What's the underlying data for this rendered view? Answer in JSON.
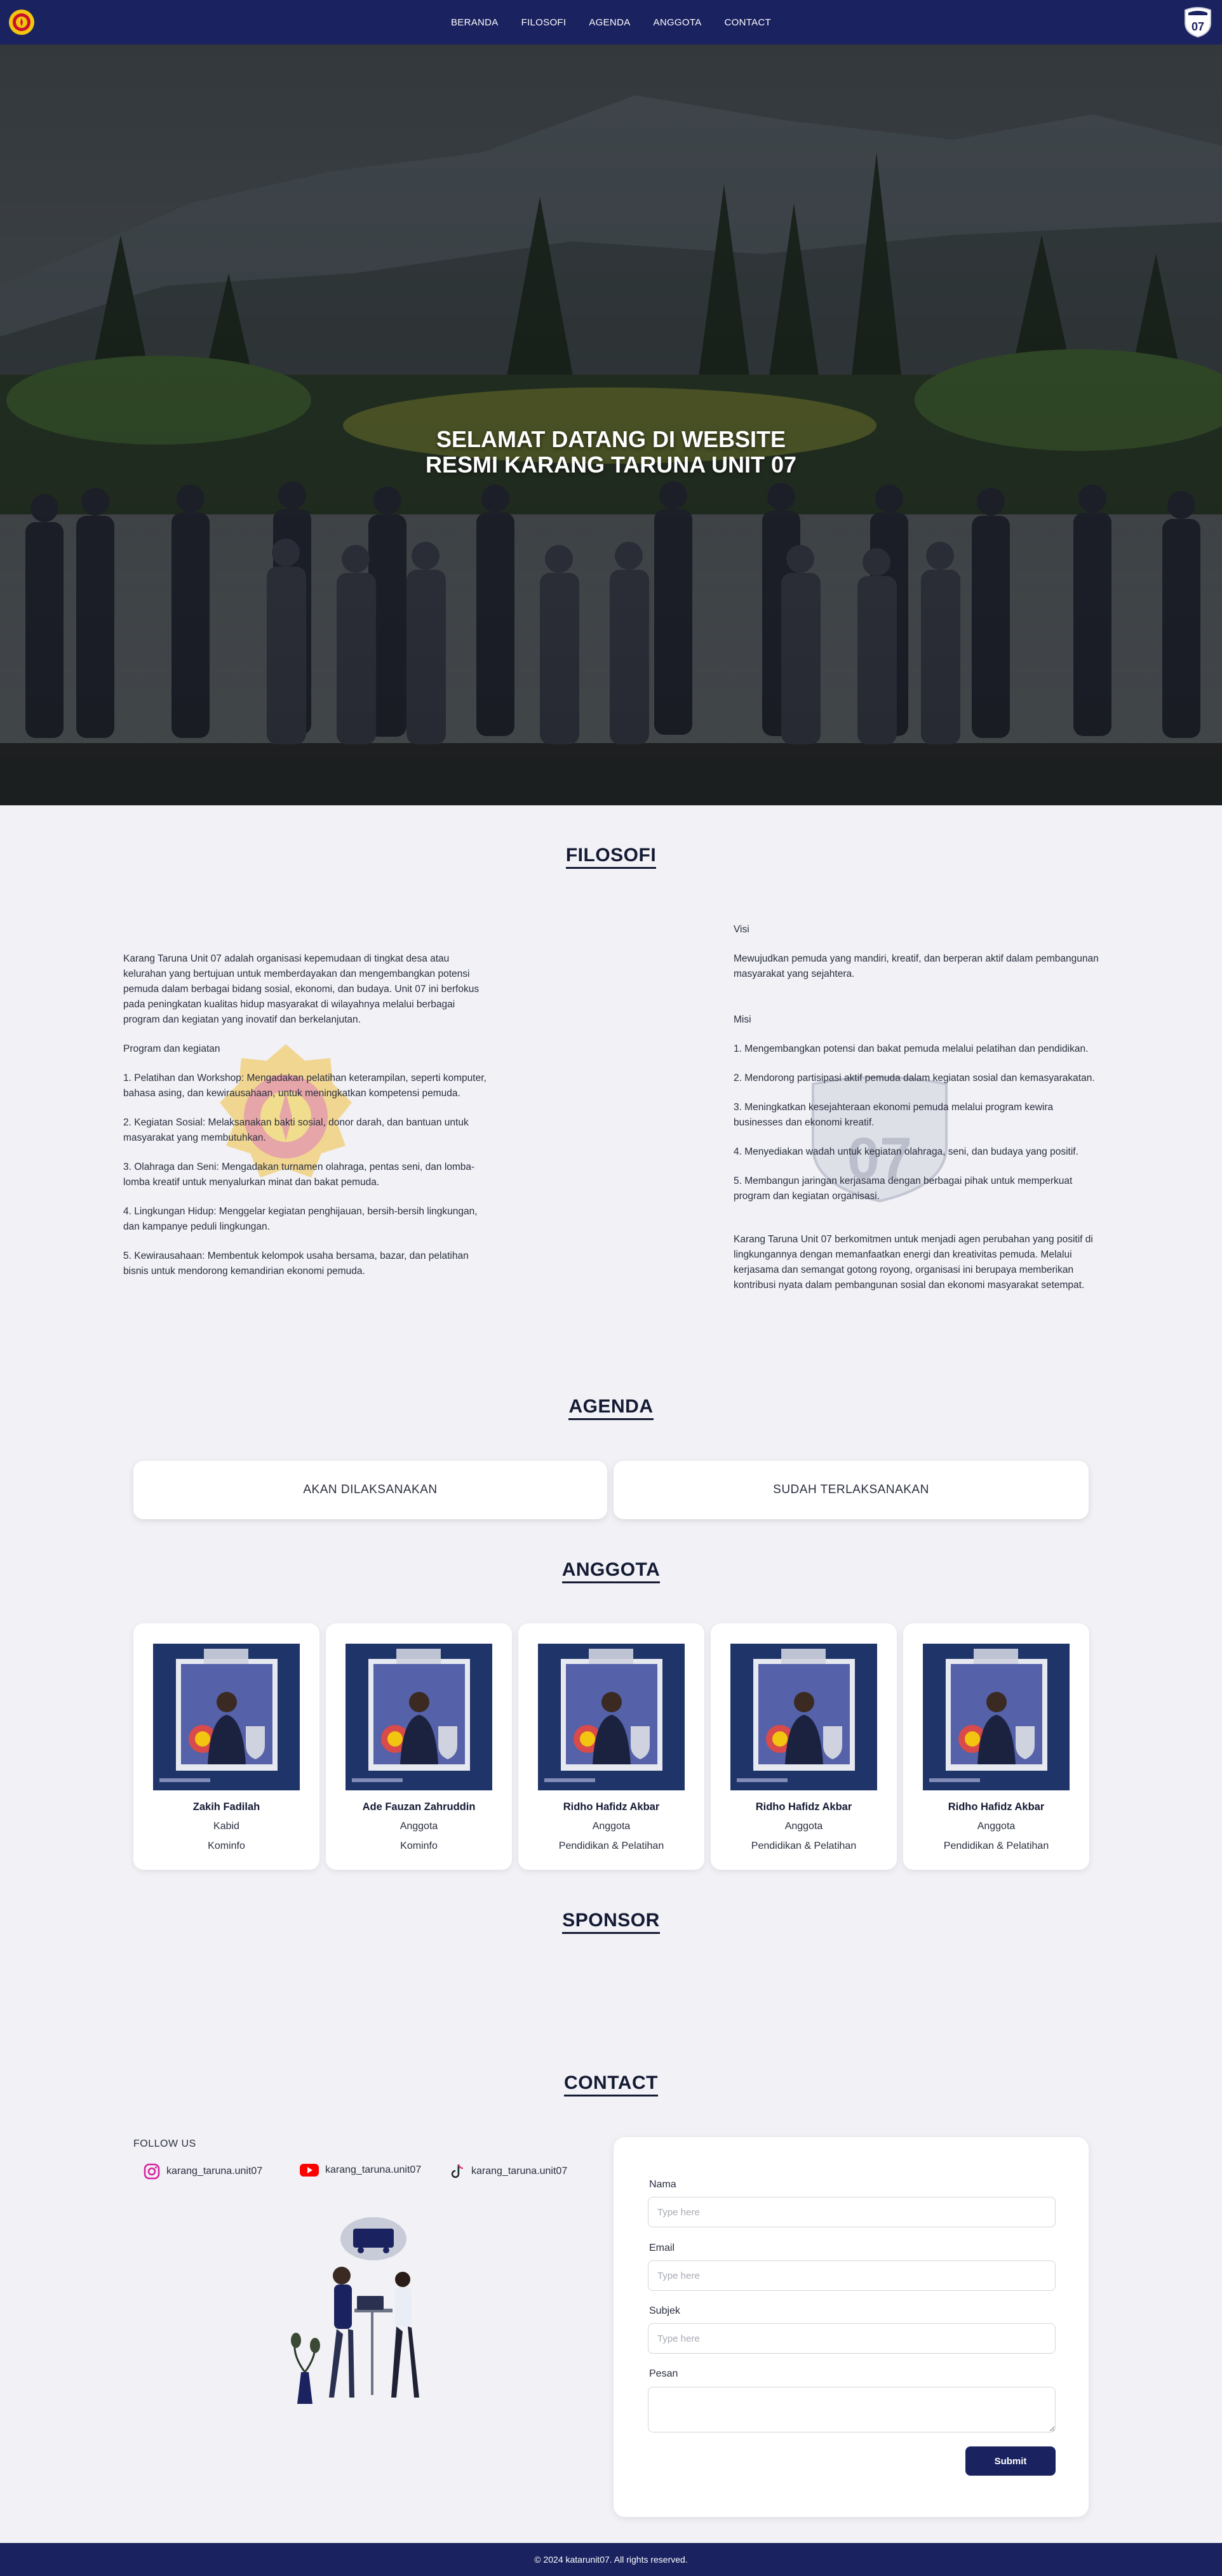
{
  "nav": {
    "links": [
      "BERANDA",
      "FILOSOFI",
      "AGENDA",
      "ANGGOTA",
      "CONTACT"
    ],
    "logo_right_text": "07"
  },
  "hero": {
    "title": "SELAMAT DATANG DI WEBSITE RESMI KARANG TARUNA UNIT 07"
  },
  "filosofi": {
    "title": "FILOSOFI",
    "left": {
      "intro": "Karang Taruna Unit 07 adalah organisasi kepemudaan di tingkat desa atau kelurahan yang bertujuan untuk memberdayakan dan mengembangkan potensi pemuda dalam berbagai bidang sosial, ekonomi, dan budaya. Unit 07 ini berfokus pada peningkatan kualitas hidup masyarakat di wilayahnya melalui berbagai program dan kegiatan yang inovatif dan berkelanjutan.",
      "program_heading": "Program dan kegiatan",
      "programs": [
        "1. Pelatihan dan Workshop: Mengadakan pelatihan keterampilan, seperti komputer, bahasa asing, dan kewirausahaan, untuk meningkatkan kompetensi pemuda.",
        "2. Kegiatan Sosial: Melaksanakan bakti sosial, donor darah, dan bantuan untuk masyarakat yang membutuhkan.",
        "3. Olahraga dan Seni: Mengadakan turnamen olahraga, pentas seni, dan lomba-lomba kreatif untuk menyalurkan minat dan bakat pemuda.",
        "4. Lingkungan Hidup: Menggelar kegiatan penghijauan, bersih-bersih lingkungan, dan kampanye peduli lingkungan.",
        "5. Kewirausahaan: Membentuk kelompok usaha bersama, bazar, dan pelatihan bisnis untuk mendorong kemandirian ekonomi pemuda."
      ]
    },
    "right": {
      "visi_heading": "Visi",
      "visi": "Mewujudkan pemuda yang mandiri, kreatif, dan berperan aktif dalam pembangunan masyarakat yang sejahtera.",
      "misi_heading": "Misi",
      "misi": [
        "1. Mengembangkan potensi dan bakat pemuda melalui pelatihan dan pendidikan.",
        "2. Mendorong partisipasi aktif pemuda dalam kegiatan sosial dan kemasyarakatan.",
        "3. Meningkatkan kesejahteraan ekonomi pemuda melalui program kewira businesses dan ekonomi kreatif.",
        "4. Menyediakan wadah untuk kegiatan olahraga, seni, dan budaya yang positif.",
        "5. Membangun jaringan kerjasama dengan berbagai pihak untuk memperkuat program dan kegiatan organisasi."
      ],
      "closing": "Karang Taruna Unit 07 berkomitmen untuk menjadi agen perubahan yang positif di lingkungannya dengan memanfaatkan energi dan kreativitas pemuda. Melalui kerjasama dan semangat gotong royong, organisasi ini berupaya memberikan kontribusi nyata dalam pembangunan sosial dan ekonomi masyarakat setempat."
    },
    "watermark_text": "UNIT 07"
  },
  "agenda": {
    "title": "AGENDA",
    "upcoming_label": "AKAN DILAKSANAKAN",
    "done_label": "SUDAH TERLAKSANAKAN"
  },
  "anggota": {
    "title": "ANGGOTA",
    "members": [
      {
        "name": "Zakih Fadilah",
        "role": "Kabid",
        "division": "Kominfo"
      },
      {
        "name": "Ade Fauzan Zahruddin",
        "role": "Anggota",
        "division": "Kominfo"
      },
      {
        "name": "Ridho Hafidz Akbar",
        "role": "Anggota",
        "division": "Pendidikan & Pelatihan"
      },
      {
        "name": "Ridho Hafidz Akbar",
        "role": "Anggota",
        "division": "Pendidikan & Pelatihan"
      },
      {
        "name": "Ridho Hafidz Akbar",
        "role": "Anggota",
        "division": "Pendidikan & Pelatihan"
      }
    ]
  },
  "sponsor": {
    "title": "SPONSOR"
  },
  "contact": {
    "title": "CONTACT",
    "follow_label": "FOLLOW US",
    "socials": [
      {
        "icon": "instagram-icon",
        "handle": "karang_taruna.unit07",
        "color": "#d6249f"
      },
      {
        "icon": "youtube-icon",
        "handle": "karang_taruna.unit07",
        "color": "#ff0000"
      },
      {
        "icon": "tiktok-icon",
        "handle": "karang_taruna.unit07",
        "color": "#222222"
      }
    ],
    "form": {
      "name_label": "Nama",
      "name_placeholder": "Type here",
      "email_label": "Email",
      "email_placeholder": "Type here",
      "subject_label": "Subjek",
      "subject_placeholder": "Type here",
      "message_label": "Pesan",
      "submit_label": "Submit"
    }
  },
  "footer": {
    "text": "© 2024 katarunit07. All rights reserved."
  },
  "colors": {
    "navy": "#1b2260",
    "background": "#f1f1f6",
    "card": "#ffffff"
  }
}
